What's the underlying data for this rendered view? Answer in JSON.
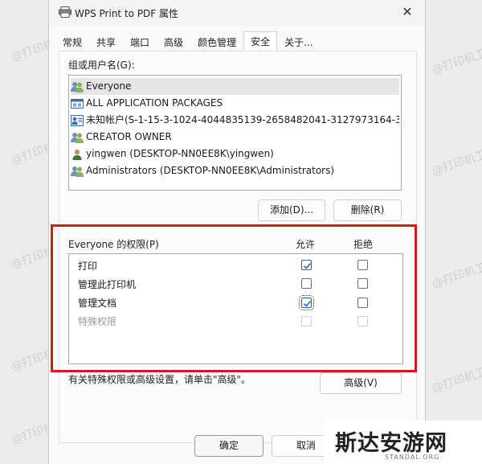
{
  "window": {
    "title": "WPS Print to PDF 属性",
    "close_glyph": "✕"
  },
  "tabs": [
    {
      "label": "常规"
    },
    {
      "label": "共享"
    },
    {
      "label": "端口"
    },
    {
      "label": "高级"
    },
    {
      "label": "颜色管理"
    },
    {
      "label": "安全",
      "active": true
    },
    {
      "label": "关于..."
    }
  ],
  "security": {
    "groups_label": "组或用户名(G):",
    "principals": [
      {
        "name": "Everyone",
        "icon": "group-icon",
        "selected": true
      },
      {
        "name": "ALL APPLICATION PACKAGES",
        "icon": "app-packages-icon"
      },
      {
        "name": "未知帐户(S-1-15-3-1024-4044835139-2658482041-3127973164-32...",
        "icon": "unknown-account-icon"
      },
      {
        "name": "CREATOR OWNER",
        "icon": "group-icon"
      },
      {
        "name": "yingwen (DESKTOP-NN0EE8K\\yingwen)",
        "icon": "user-icon"
      },
      {
        "name": "Administrators (DESKTOP-NN0EE8K\\Administrators)",
        "icon": "group-icon"
      }
    ],
    "add_label": "添加(D)...",
    "remove_label": "删除(R)",
    "perm_label": "Everyone 的权限(P)",
    "allow_header": "允许",
    "deny_header": "拒绝",
    "permissions": [
      {
        "name": "打印",
        "allow": true,
        "deny": false,
        "enabled": true
      },
      {
        "name": "管理此打印机",
        "allow": false,
        "deny": false,
        "enabled": true
      },
      {
        "name": "管理文档",
        "allow": true,
        "deny": false,
        "enabled": true,
        "focused": true
      },
      {
        "name": "特殊权限",
        "allow": false,
        "deny": false,
        "enabled": false
      }
    ],
    "advanced_hint": "有关特殊权限或高级设置，请单击\"高级\"。",
    "advanced_label": "高级(V)"
  },
  "footer": {
    "ok_label": "确定",
    "cancel_label": "取消"
  },
  "watermark": {
    "text": "@打印机卫士"
  },
  "logo": {
    "main": "斯达安游网",
    "sub": "STANDAL.ORG"
  },
  "colors": {
    "highlight_frame": "#d9181c",
    "checkbox_check": "#2163b8",
    "selection": "#e5e5e5"
  }
}
